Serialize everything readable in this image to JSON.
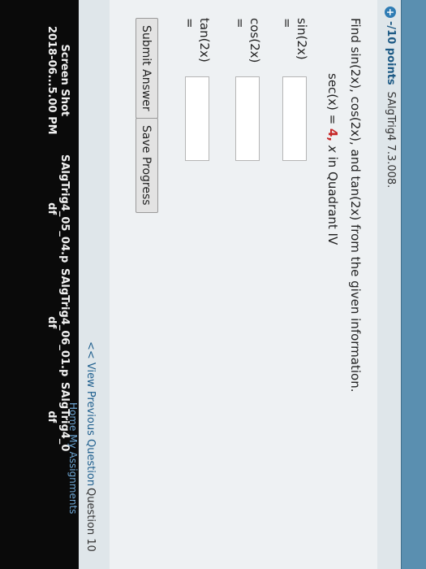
{
  "header": {
    "points": "-/10 points",
    "problem_id": "SAlgTrig4 7.3.008."
  },
  "question": {
    "prompt": "Find sin(2x), cos(2x), and tan(2x) from the given information.",
    "given_prefix": "sec(x) = ",
    "given_value": "4,",
    "given_var": "x",
    "given_suffix": " in Quadrant IV"
  },
  "answers": {
    "sin_label": "sin(2x) =",
    "cos_label": "cos(2x) =",
    "tan_label": "tan(2x) ="
  },
  "buttons": {
    "submit": "Submit Answer",
    "save": "Save Progress"
  },
  "nav": {
    "previous": "<< View Previous Question",
    "question_number": "Question 10"
  },
  "dock": {
    "item1_line1": "Screen Shot",
    "item1_line2": "2018-06...5.00 PM",
    "item2_line1": "SAlgTrig4_05_04.p",
    "item2_line2": "df",
    "item3_line1": "SAlgTrig4_06_01.p",
    "item3_line2": "df",
    "item4_line1": "SAlgTrig4_0",
    "item4_line2": "df",
    "hint": "Home   My Assignments"
  },
  "colors": {
    "header_bar": "#5a8fb0",
    "link": "#1f5f8e",
    "given_value": "#c62828"
  }
}
